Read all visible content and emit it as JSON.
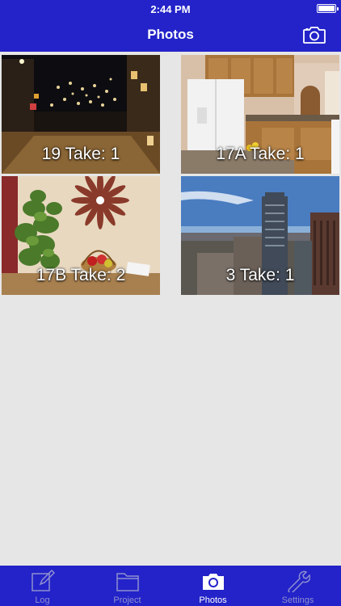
{
  "status_bar": {
    "time": "2:44 PM",
    "battery_level": 1.0
  },
  "nav": {
    "title": "Photos",
    "right_icon": "camera-icon"
  },
  "photos": [
    {
      "caption": "19 Take: 1",
      "scene": "night-street"
    },
    {
      "caption": "17A Take: 1",
      "scene": "kitchen"
    },
    {
      "caption": "17B Take: 2",
      "scene": "plant-wall"
    },
    {
      "caption": "3 Take: 1",
      "scene": "city-skyline"
    }
  ],
  "tabs": [
    {
      "label": "Log",
      "icon": "log-icon",
      "active": false
    },
    {
      "label": "Project",
      "icon": "folder-icon",
      "active": false
    },
    {
      "label": "Photos",
      "icon": "camera-icon",
      "active": true
    },
    {
      "label": "Settings",
      "icon": "wrench-icon",
      "active": false
    }
  ],
  "colors": {
    "brand_blue": "#2323c9",
    "background": "#e6e6e6",
    "tab_inactive": "#8f8fd0",
    "tab_active": "#ffffff"
  }
}
